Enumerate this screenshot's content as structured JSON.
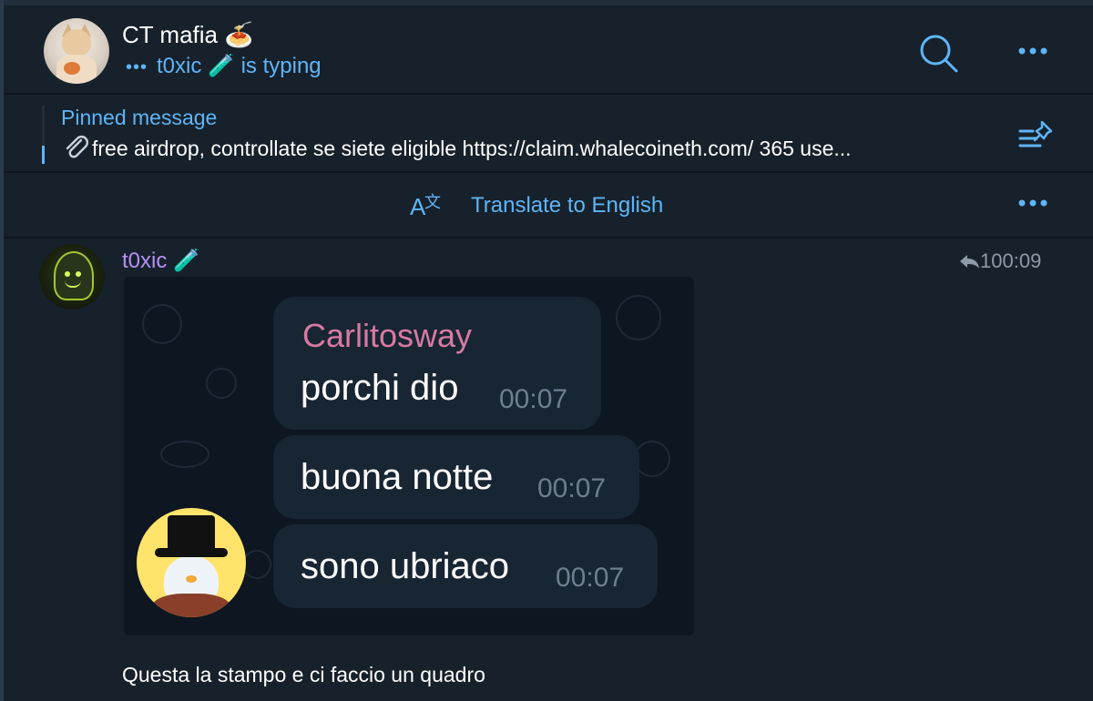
{
  "header": {
    "title": "CT mafia 🍝",
    "typing_dots": "•••",
    "typing_user": "t0xic 🧪",
    "typing_suffix": "is typing"
  },
  "pinned": {
    "label": "Pinned message",
    "text": "free airdrop, controllate se siete eligible https://claim.whalecoineth.com/  365 use..."
  },
  "translate": {
    "label": "Translate to English"
  },
  "message": {
    "sender": "t0xic 🧪",
    "reply_count": "1",
    "time": "00:09",
    "caption": "Questa la stampo e ci faccio un quadro",
    "embedded": {
      "name": "Carlitosway",
      "bubbles": [
        {
          "text": "porchi dio",
          "time": "00:07"
        },
        {
          "text": "buona notte",
          "time": "00:07"
        },
        {
          "text": "sono ubriaco",
          "time": "00:07"
        }
      ]
    }
  },
  "colors": {
    "background": "#17212b",
    "accent": "#5eb5f7",
    "sender_name": "#b68ff5",
    "embedded_name": "#d87aa3"
  }
}
